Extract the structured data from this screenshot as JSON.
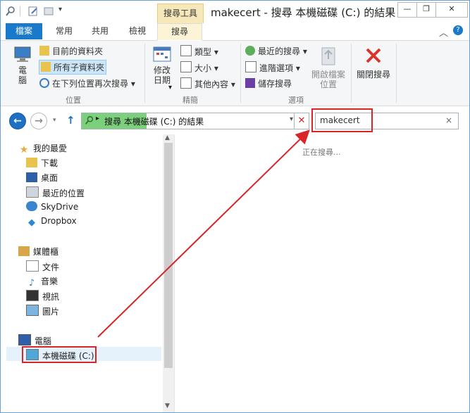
{
  "window": {
    "title": "makecert - 搜尋 本機磁碟 (C:) 的結果",
    "context_tab_header": "搜尋工具",
    "controls": [
      "—",
      "❐",
      "✕"
    ]
  },
  "tabs": [
    "檔案",
    "常用",
    "共用",
    "檢視",
    "搜尋"
  ],
  "ribbon": {
    "location": {
      "computer": "電\n腦",
      "current_folder": "目前的資料夾",
      "all_subfolders": "所有子資料夾",
      "search_again_in": "在下列位置再次搜尋",
      "group_label": "位置"
    },
    "refine": {
      "date_modified": "修改\n日期",
      "kind": "類型",
      "size": "大小",
      "other_properties": "其他內容",
      "group_label": "精簡"
    },
    "options": {
      "recent_searches": "最近的搜尋",
      "advanced_options": "進階選項",
      "save_search": "儲存搜尋",
      "open_file_location": "開啟檔案\n位置",
      "group_label": "選項"
    },
    "close": {
      "close_search": "關閉搜尋"
    }
  },
  "address": {
    "path_text": "搜尋 本機磁碟 (C:) 的結果"
  },
  "search": {
    "value": "makecert"
  },
  "nav": {
    "favorites": "我的最愛",
    "fav_items": [
      "下載",
      "桌面",
      "最近的位置",
      "SkyDrive",
      "Dropbox"
    ],
    "libraries": "媒體櫃",
    "lib_items": [
      "文件",
      "音樂",
      "視訊",
      "圖片"
    ],
    "computer": "電腦",
    "local_disk": "本機磁碟 (C:)"
  },
  "content": {
    "status": "正在搜尋..."
  },
  "colors": {
    "accent": "#1979ca",
    "highlight_red": "#d9252a",
    "progress_green": "#7cd07c"
  }
}
